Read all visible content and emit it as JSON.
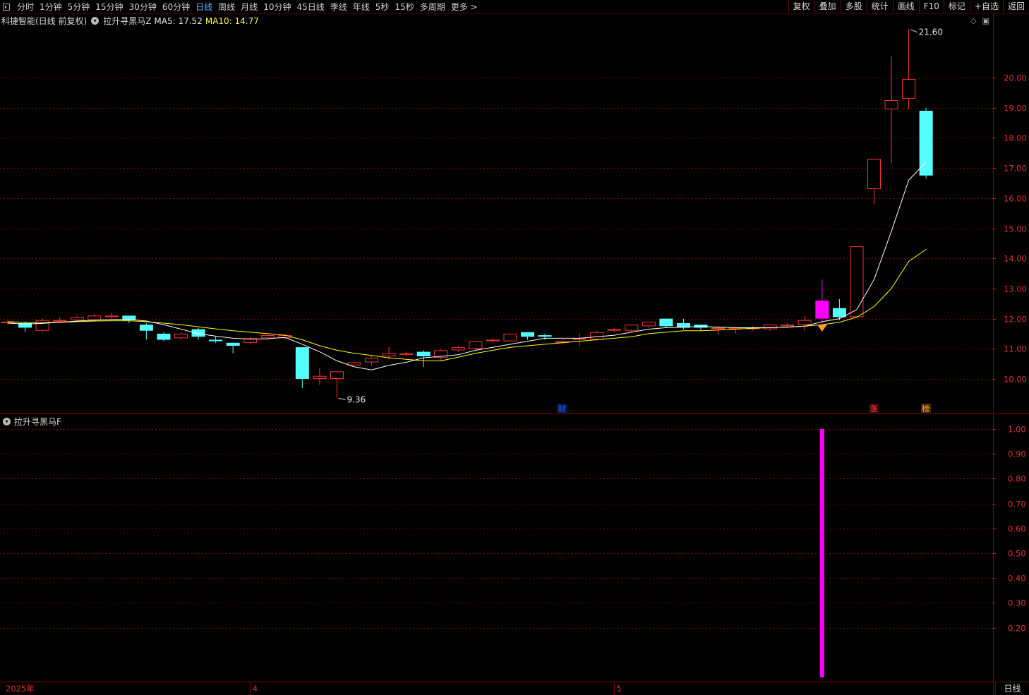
{
  "toolbar": {
    "periods": [
      "分时",
      "1分钟",
      "5分钟",
      "15分钟",
      "30分钟",
      "60分钟",
      "日线",
      "周线",
      "月线",
      "10分钟",
      "45日线",
      "季线",
      "年线",
      "5秒",
      "15秒",
      "多周期",
      "更多 >"
    ],
    "active_period": "日线",
    "right_buttons": [
      "复权",
      "叠加",
      "多股",
      "统计",
      "画线",
      "F10",
      "标记",
      "+自选",
      "返回"
    ]
  },
  "header": {
    "stock": "科捷智能(日线 前复权)",
    "indicator_z": "拉升寻黑马Z",
    "ma5": "MA5: 17.52",
    "ma10": "MA10: 14.77"
  },
  "indicator": {
    "title": "拉升寻黑马F"
  },
  "footer": {
    "period_label": "日线"
  },
  "colors": {
    "up": "#ff3232",
    "down": "#54ffff",
    "ma5": "#ffffff",
    "ma10": "#ffff00",
    "signal": "#ff00ff",
    "grid": "#7a0000"
  },
  "chart_data": {
    "type": "candlestick",
    "main": {
      "ylim": [
        9.0,
        22.5
      ],
      "y_ticks": [
        10.0,
        11.0,
        12.0,
        13.0,
        14.0,
        15.0,
        16.0,
        17.0,
        18.0,
        19.0,
        20.0
      ],
      "y_tick_labels": [
        "10.00",
        "11.00",
        "12.00",
        "13.00",
        "14.00",
        "15.00",
        "16.00",
        "17.00",
        "18.00",
        "19.00",
        "20.00"
      ],
      "annotations": {
        "high": "21.60",
        "low": "9.36"
      },
      "markers": [
        "财",
        "涨",
        "榜"
      ],
      "candles": [
        [
          11.85,
          11.9,
          11.8,
          11.95
        ],
        [
          11.85,
          11.7,
          11.55,
          11.9
        ],
        [
          11.6,
          11.95,
          11.55,
          12.0
        ],
        [
          11.95,
          11.95,
          11.9,
          12.05
        ],
        [
          11.95,
          12.05,
          11.9,
          12.1
        ],
        [
          11.95,
          12.1,
          11.9,
          12.15
        ],
        [
          12.05,
          12.1,
          12.0,
          12.2
        ],
        [
          12.1,
          11.95,
          11.85,
          12.1
        ],
        [
          11.8,
          11.6,
          11.3,
          11.85
        ],
        [
          11.5,
          11.3,
          11.25,
          11.55
        ],
        [
          11.35,
          11.5,
          11.3,
          11.55
        ],
        [
          11.65,
          11.4,
          11.3,
          11.7
        ],
        [
          11.3,
          11.25,
          11.2,
          11.4
        ],
        [
          11.2,
          11.1,
          10.85,
          11.2
        ],
        [
          11.2,
          11.35,
          11.15,
          11.4
        ],
        [
          11.35,
          11.45,
          11.3,
          11.5
        ],
        [
          11.35,
          11.45,
          11.3,
          11.5
        ],
        [
          11.05,
          10.0,
          9.7,
          11.05
        ],
        [
          10.0,
          10.1,
          9.8,
          10.35
        ],
        [
          10.0,
          10.25,
          9.36,
          10.25
        ],
        [
          10.45,
          10.55,
          10.45,
          10.55
        ],
        [
          10.55,
          10.7,
          10.45,
          10.75
        ],
        [
          10.75,
          10.85,
          10.65,
          11.05
        ],
        [
          10.8,
          10.85,
          10.75,
          10.9
        ],
        [
          10.9,
          10.75,
          10.4,
          10.95
        ],
        [
          10.7,
          10.95,
          10.6,
          11.0
        ],
        [
          10.95,
          11.05,
          10.9,
          11.1
        ],
        [
          11.0,
          11.25,
          10.95,
          11.25
        ],
        [
          11.3,
          11.3,
          11.2,
          11.35
        ],
        [
          11.25,
          11.5,
          11.25,
          11.5
        ],
        [
          11.55,
          11.4,
          11.3,
          11.55
        ],
        [
          11.45,
          11.4,
          11.3,
          11.5
        ],
        [
          11.2,
          11.25,
          11.15,
          11.3
        ],
        [
          11.3,
          11.35,
          11.1,
          11.5
        ],
        [
          11.3,
          11.55,
          11.25,
          11.6
        ],
        [
          11.6,
          11.65,
          11.55,
          11.7
        ],
        [
          11.6,
          11.8,
          11.55,
          11.8
        ],
        [
          11.75,
          11.9,
          11.7,
          11.9
        ],
        [
          12.0,
          11.75,
          11.7,
          12.0
        ],
        [
          11.85,
          11.7,
          11.65,
          12.0
        ],
        [
          11.8,
          11.7,
          11.6,
          11.8
        ],
        [
          11.7,
          11.7,
          11.45,
          11.75
        ],
        [
          11.65,
          11.7,
          11.5,
          11.7
        ],
        [
          11.65,
          11.7,
          11.6,
          11.75
        ],
        [
          11.65,
          11.8,
          11.6,
          11.8
        ],
        [
          11.75,
          11.8,
          11.7,
          11.85
        ],
        [
          11.8,
          11.95,
          11.6,
          12.1
        ],
        [
          12.0,
          12.6,
          11.85,
          13.3
        ],
        [
          12.35,
          12.05,
          11.95,
          12.65
        ],
        [
          12.05,
          14.4,
          12.05,
          14.4
        ],
        [
          16.3,
          17.3,
          15.8,
          17.3
        ],
        [
          18.95,
          19.25,
          17.15,
          20.7
        ],
        [
          19.3,
          19.95,
          18.95,
          21.6
        ],
        [
          18.9,
          16.75,
          16.65,
          19.0
        ]
      ],
      "ma5": [
        11.85,
        11.82,
        11.84,
        11.88,
        11.92,
        11.95,
        11.97,
        11.98,
        11.92,
        11.8,
        11.65,
        11.5,
        11.42,
        11.35,
        11.32,
        11.33,
        11.38,
        11.15,
        10.9,
        10.6,
        10.4,
        10.3,
        10.45,
        10.55,
        10.7,
        10.75,
        10.8,
        10.95,
        11.05,
        11.15,
        11.25,
        11.35,
        11.35,
        11.35,
        11.4,
        11.45,
        11.55,
        11.65,
        11.7,
        11.72,
        11.74,
        11.72,
        11.7,
        11.7,
        11.7,
        11.72,
        11.75,
        11.9,
        12.0,
        12.3,
        13.3,
        14.9,
        16.6,
        17.2
      ],
      "ma10": [
        11.9,
        11.88,
        11.87,
        11.88,
        11.9,
        11.92,
        11.93,
        11.93,
        11.9,
        11.85,
        11.8,
        11.73,
        11.66,
        11.6,
        11.55,
        11.5,
        11.45,
        11.3,
        11.1,
        10.95,
        10.85,
        10.78,
        10.7,
        10.65,
        10.6,
        10.6,
        10.72,
        10.85,
        10.95,
        11.05,
        11.1,
        11.15,
        11.2,
        11.25,
        11.3,
        11.35,
        11.4,
        11.5,
        11.55,
        11.6,
        11.6,
        11.62,
        11.65,
        11.68,
        11.7,
        11.72,
        11.75,
        11.8,
        11.88,
        12.05,
        12.4,
        13.0,
        13.9,
        14.3
      ]
    },
    "indicator": {
      "ylim": [
        0,
        1.05
      ],
      "y_ticks": [
        0.2,
        0.3,
        0.4,
        0.5,
        0.6,
        0.7,
        0.8,
        0.9,
        1.0
      ],
      "y_tick_labels": [
        "0.20",
        "0.30",
        "0.40",
        "0.50",
        "0.60",
        "0.70",
        "0.80",
        "0.90",
        "1.00"
      ],
      "signal_index": 47,
      "signal_value": 1.0
    },
    "x_labels": [
      {
        "index": 0,
        "label": "2025年"
      },
      {
        "index": 14,
        "label": "4"
      },
      {
        "index": 35,
        "label": "5"
      }
    ]
  }
}
